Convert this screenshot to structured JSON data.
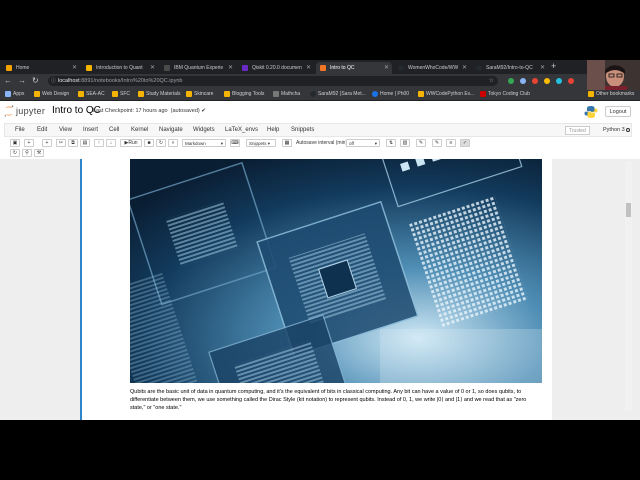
{
  "browser": {
    "tabs": [
      {
        "label": "Home",
        "color": "#f4a300"
      },
      {
        "label": "Introduction to Quant",
        "color": "#f4b400"
      },
      {
        "label": "IBM Quantum Experie",
        "color": "#4a4a4a"
      },
      {
        "label": "Qiskit 0.20.0 documen",
        "color": "#6929c4"
      },
      {
        "label": "Intro to QC",
        "color": "#f37726"
      },
      {
        "label": "WomenWhoCode/WW",
        "color": "#24292e"
      },
      {
        "label": "SaraM92/Intro-to-QC",
        "color": "#24292e"
      }
    ],
    "new_tab": "+",
    "url_host": "localhost",
    "url_path": ":8891/notebooks/Intro%20to%20QC.ipynb",
    "bookmarks": [
      {
        "label": "Apps",
        "color": "#8ab4f8"
      },
      {
        "label": "Web Design",
        "color": "#f4b400"
      },
      {
        "label": "SEA-AC",
        "color": "#f4b400"
      },
      {
        "label": "SFC",
        "color": "#f4b400"
      },
      {
        "label": "Study Materials",
        "color": "#f4b400"
      },
      {
        "label": "Skincare",
        "color": "#f4b400"
      },
      {
        "label": "Blogging Tools",
        "color": "#f4b400"
      },
      {
        "label": "Mathcha",
        "color": "#777"
      },
      {
        "label": "SaraM92 (Sara Met...",
        "color": "#24292e"
      },
      {
        "label": "Home | Ph00",
        "color": "#1a73e8"
      },
      {
        "label": "WWCodePython Ev...",
        "color": "#f4b400"
      },
      {
        "label": "Tokyo Coding Club",
        "color": "#cc0000"
      },
      {
        "label": "Other bookmarks",
        "color": "#f4b400"
      }
    ]
  },
  "jupyter": {
    "logo_text": "jupyter",
    "notebook_name": "Intro to QC",
    "checkpoint": "Last Checkpoint: 17 hours ago",
    "autosave": "(autosaved)",
    "logout": "Logout",
    "menus": [
      "File",
      "Edit",
      "View",
      "Insert",
      "Cell",
      "Kernel",
      "Navigate",
      "Widgets",
      "LaTeX_envs",
      "Help",
      "Snippets"
    ],
    "trusted": "Trusted",
    "kernel": "Python 3",
    "toolbar": {
      "run": "Run",
      "cell_type": "Markdown",
      "snippets": "Snippets",
      "autosave_label": "Autosave interval (min):",
      "autosave_value": "off"
    },
    "paragraph": "Qubits are the basic unit of data in quantum computing, and it's the equivalent of bits in classical computing. Any bit can have a value of 0 or 1, so does qubits, to differentiate between them, we use something called the Dirac Style (kit notation) to represent qubits. Instead of 0, 1, we write |0⟩ and |1⟩ and we read that as \"zero state,\" or \"one state.\""
  }
}
